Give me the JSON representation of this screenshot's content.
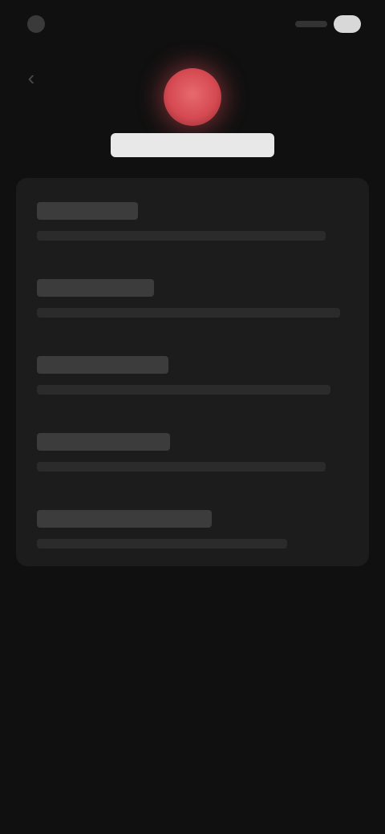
{
  "status_bar": {
    "time": "",
    "battery": ""
  },
  "header": {
    "title": "",
    "back_icon": "back-arrow-icon",
    "app_icon": "red-circle-icon",
    "accent_color": "#d64a52"
  },
  "list": {
    "items": [
      {
        "title": "",
        "description": ""
      },
      {
        "title": "",
        "description": ""
      },
      {
        "title": "",
        "description": ""
      },
      {
        "title": "",
        "description": ""
      },
      {
        "title": "",
        "description": ""
      }
    ]
  }
}
